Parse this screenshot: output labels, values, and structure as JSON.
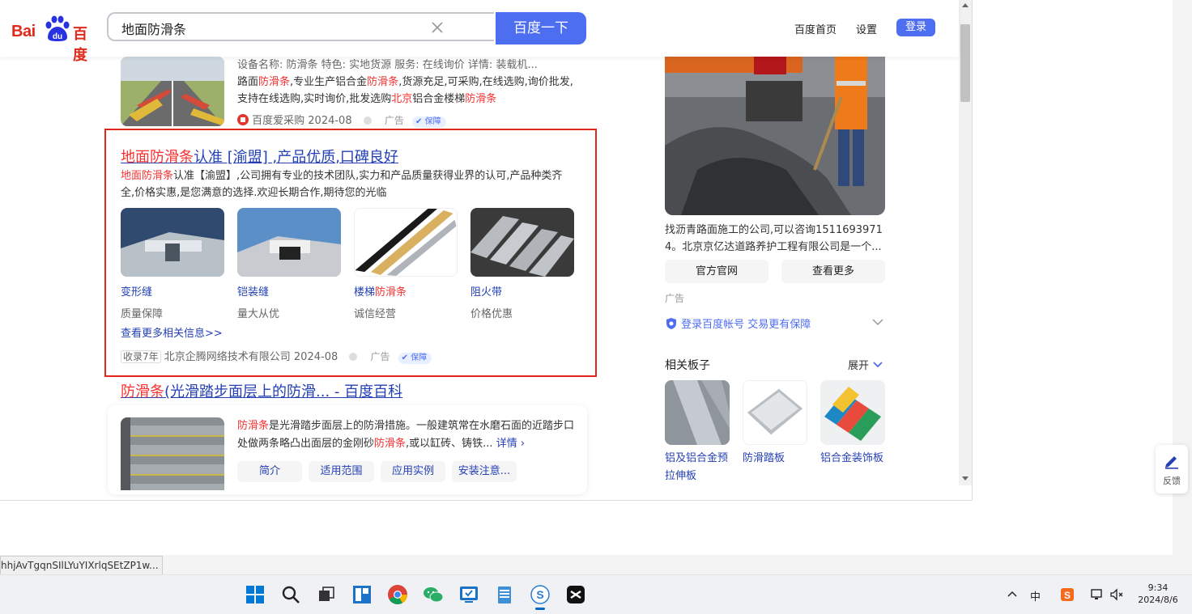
{
  "header": {
    "logo_left": "Bai",
    "logo_right": "百度",
    "search_value": "地面防滑条",
    "search_button": "百度一下",
    "link_home": "百度首页",
    "link_settings": "设置",
    "login_label": "登录"
  },
  "result1": {
    "meta_line": "设备名称: 防滑条    特色: 实地货源    服务: 在线询价    详情: 装载机...",
    "line2_a": "路面",
    "line2_kw1": "防滑条",
    "line2_b": ",专业生产铝合金",
    "line2_kw2": "防滑条",
    "line2_c": ",货源充足,可采购,在线选购,询价批发,",
    "line3_a": "支持在线选购,实时询价,批发选购",
    "line3_kw1": "北京",
    "line3_b": "铝合金楼梯",
    "line3_kw2": "防滑条",
    "source": "百度爱采购 2024-08",
    "ad_label": "广告",
    "guarantee": "保障"
  },
  "ad_result": {
    "title_kw": "地面防滑条",
    "title_rest": "认准 [渝盟] ,产品优质,口碑良好",
    "desc_kw": "地面防滑条",
    "desc_rest": "认准【渝盟】,公司拥有专业的技术团队,实力和产品质量获得业界的认可,产品种类齐全,价格实惠,是您满意的选择.欢迎长期合作,期待您的光临",
    "products": [
      {
        "name": "变形缝",
        "sub": "质量保障"
      },
      {
        "name": "铠装缝",
        "sub": "量大从优"
      },
      {
        "name_a": "楼梯",
        "name_kw": "防滑条",
        "sub": "诚信经营"
      },
      {
        "name": "阻火带",
        "sub": "价格优惠"
      }
    ],
    "more_link": "查看更多相关信息>>",
    "years_tag": "收录7年",
    "source": "北京企腾网络技术有限公司 2024-08",
    "ad_label": "广告",
    "guarantee": "保障"
  },
  "baike": {
    "title_kw": "防滑条",
    "title_rest": "(光滑踏步面层上的防滑... - 百度百科",
    "desc_kw1": "防滑条",
    "desc_a": "是光滑踏步面层上的防滑措施。一般建筑常在水磨石面的近踏步口处做两条略凸出面层的金刚砂",
    "desc_kw2": "防滑条",
    "desc_b": ",或以缸砖、铸铁...",
    "detail": "详情 ›",
    "chips": [
      "简介",
      "适用范围",
      "应用实例",
      "安装注意..."
    ]
  },
  "right": {
    "desc": "找沥青路面施工的公司,可以咨询15116939714。北京京亿达道路养护工程有限公司是一个...",
    "btn_official": "官方官网",
    "btn_more": "查看更多",
    "ad_label": "广告",
    "login_tip": "登录百度帐号 交易更有保障",
    "related_title": "相关板子",
    "expand": "展开",
    "related": [
      {
        "name": "铝及铝合金预拉伸板"
      },
      {
        "name": "防滑踏板"
      },
      {
        "name": "铝合金装饰板"
      }
    ]
  },
  "feedback": "反馈",
  "status_url": "hhjAvTgqnSIlLYuYIXrlqSEtZP1w...",
  "taskbar": {
    "time": "9:34",
    "date": "2024/8/6",
    "ime": "中"
  }
}
